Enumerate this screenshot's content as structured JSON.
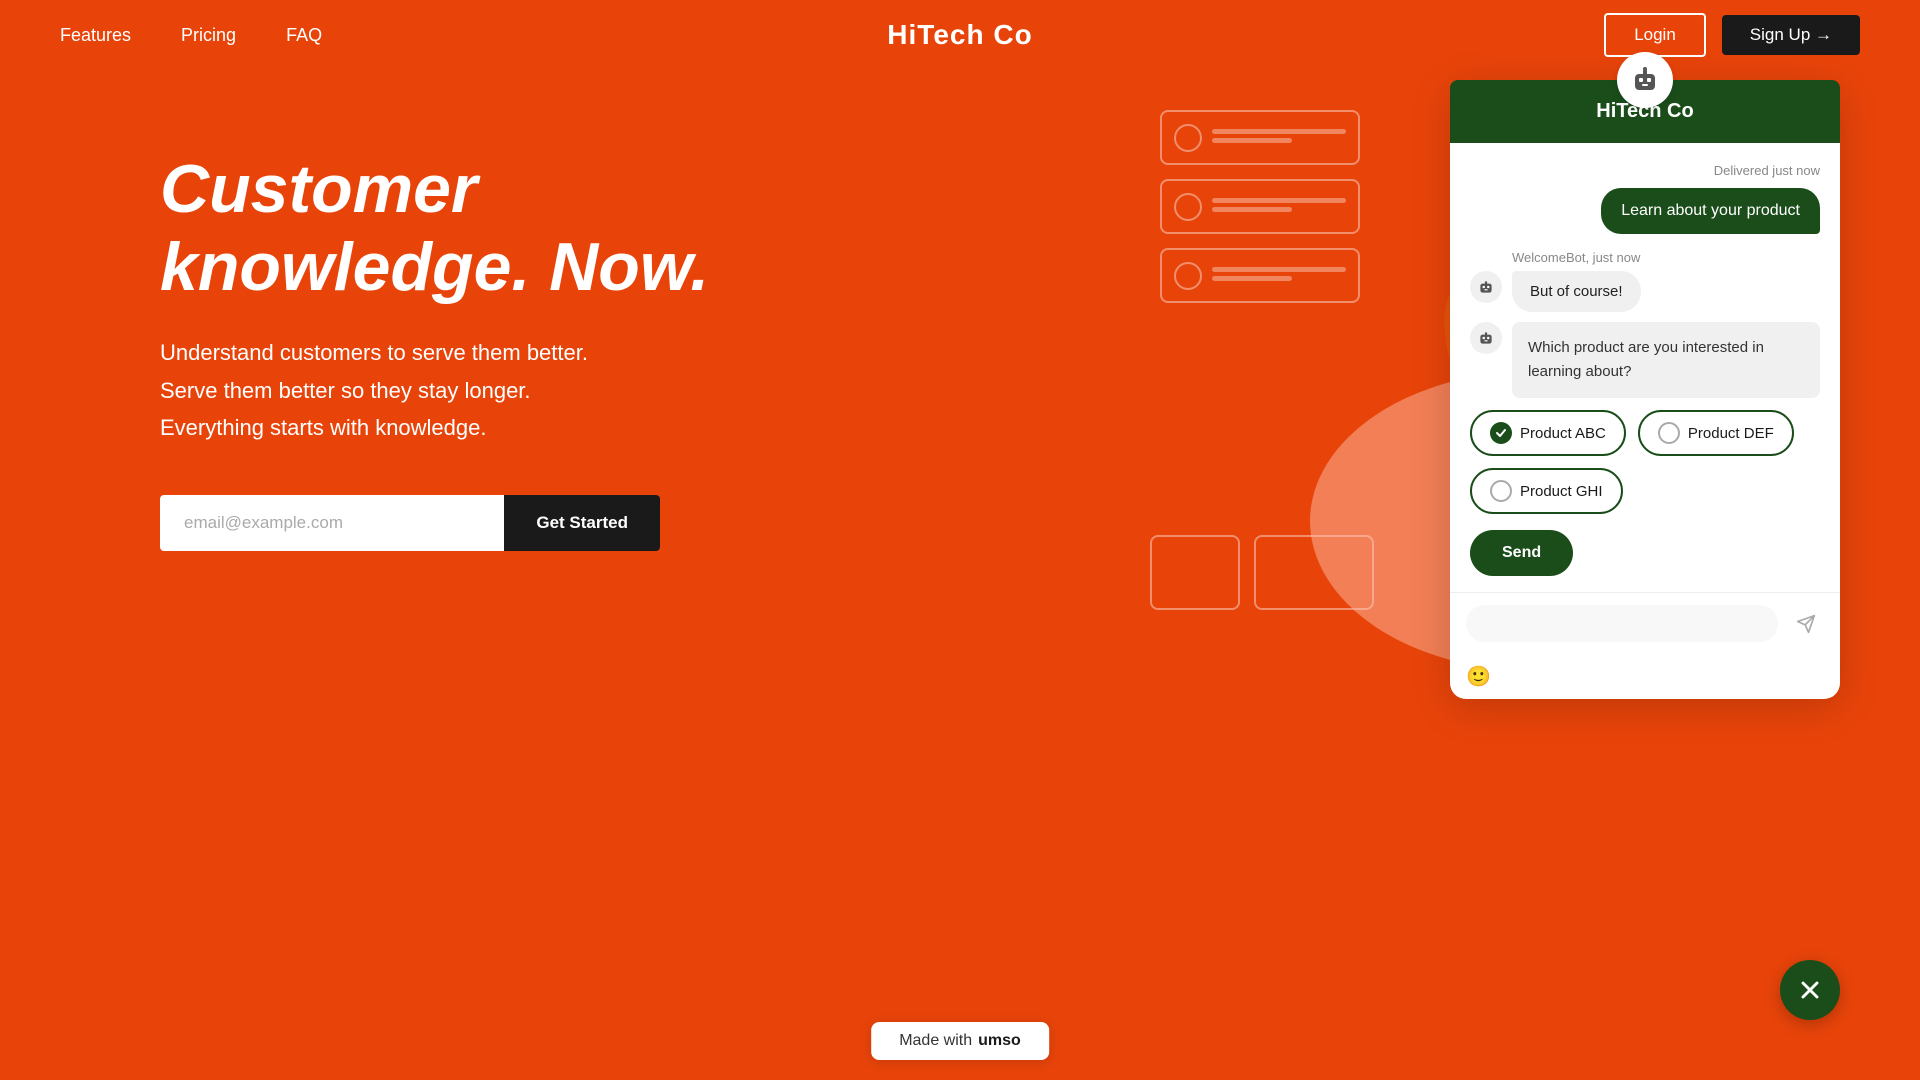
{
  "nav": {
    "links": [
      {
        "id": "features",
        "label": "Features"
      },
      {
        "id": "pricing",
        "label": "Pricing"
      },
      {
        "id": "faq",
        "label": "FAQ"
      }
    ],
    "logo": "HiTech Co",
    "login_label": "Login",
    "signup_label": "Sign Up →"
  },
  "hero": {
    "heading": "Customer knowledge. Now.",
    "subtext_line1": "Understand customers to serve them better.",
    "subtext_line2": "Serve them better so they stay longer.",
    "subtext_line3": "Everything starts with knowledge.",
    "email_placeholder": "email@example.com",
    "cta_label": "Get Started"
  },
  "footer_bar": {
    "made_with": "Made with",
    "brand": "umso"
  },
  "chat": {
    "header_title": "HiTech Co",
    "delivered_label": "Delivered just now",
    "user_message": "Learn about your product",
    "bot_sender": "WelcomeBot, just now",
    "bot_reply": "But of course!",
    "bot_question": "Which product are you interested in learning about?",
    "options": [
      {
        "id": "product-abc",
        "label": "Product ABC",
        "selected": true
      },
      {
        "id": "product-def",
        "label": "Product DEF",
        "selected": false
      },
      {
        "id": "product-ghi",
        "label": "Product GHI",
        "selected": false
      }
    ],
    "send_label": "Send",
    "input_placeholder": "",
    "emoji_icon": "🙂"
  }
}
